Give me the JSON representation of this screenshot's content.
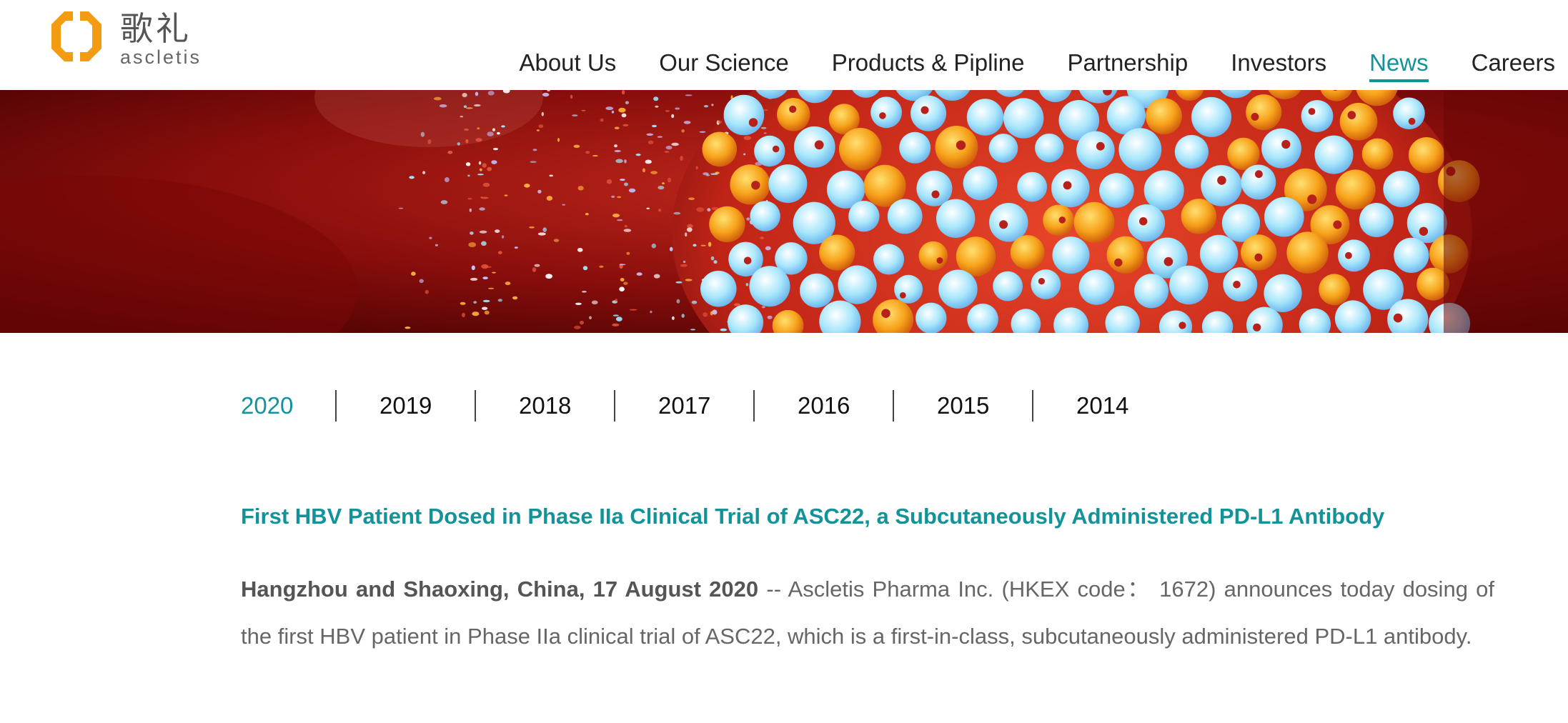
{
  "brand": {
    "name_cn": "歌礼",
    "name_en": "ascletis",
    "colors": {
      "accent": "#12939a",
      "logo_orange": "#f39c12"
    }
  },
  "nav": {
    "items": [
      {
        "label": "About Us"
      },
      {
        "label": "Our Science"
      },
      {
        "label": "Products & Pipline"
      },
      {
        "label": "Partnership"
      },
      {
        "label": "Investors"
      },
      {
        "label": "News",
        "active": true
      },
      {
        "label": "Careers"
      }
    ]
  },
  "years": {
    "items": [
      "2020",
      "2019",
      "2018",
      "2017",
      "2016",
      "2015",
      "2014"
    ],
    "active": "2020"
  },
  "article": {
    "title": "First HBV Patient Dosed in Phase IIa Clinical Trial of ASC22, a Subcutaneously Administered PD-L1 Antibody",
    "dateline": "Hangzhou and Shaoxing, China, 17 August 2020",
    "body": " -- Ascletis Pharma Inc. (HKEX code： 1672) announces today dosing of the first HBV patient in Phase IIa clinical trial of ASC22, which is a first-in-class, subcutaneously administered PD-L1 antibody."
  }
}
